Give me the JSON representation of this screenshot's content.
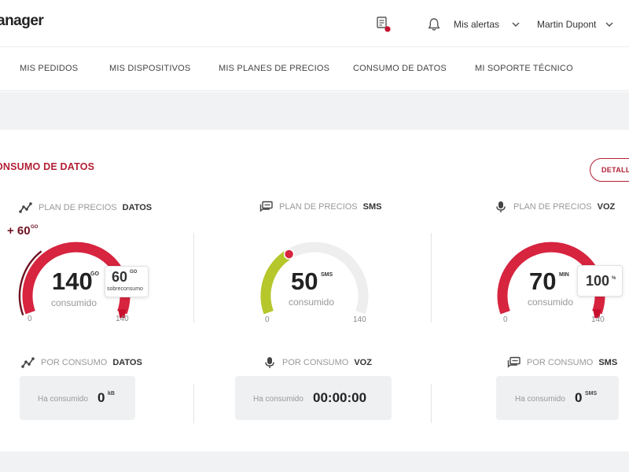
{
  "header": {
    "logo_text": "anager",
    "alerts_label": "Mis alertas",
    "user_name": "Martin Dupont"
  },
  "nav": {
    "items": [
      "MIS PEDIDOS",
      "MIS DISPOSITIVOS",
      "MIS PLANES DE PRECIOS",
      "CONSUMO DE DATOS",
      "MI SOPORTE TÉCNICO"
    ]
  },
  "section": {
    "title": "ONSUMO DE DATOS",
    "details_button": "DETALLE"
  },
  "plans": [
    {
      "prefix": "PLAN DE PRECIOS",
      "type": "DATOS",
      "icon": "data-trend-icon",
      "value": "140",
      "unit": "GO",
      "label": "consumido",
      "min": "0",
      "max": "140",
      "fraction": 1.0,
      "color": "#d7243f",
      "bubble_value": "60",
      "bubble_unit": "GO",
      "bubble_label": "sobreconsumo",
      "overage": "+ 60",
      "overage_unit": "GO"
    },
    {
      "prefix": "PLAN DE PRECIOS",
      "type": "SMS",
      "icon": "sms-icon",
      "value": "50",
      "unit": "SMS",
      "label": "consumido",
      "min": "0",
      "max": "140",
      "fraction": 0.357,
      "color": "#b5c72a"
    },
    {
      "prefix": "PLAN DE PRECIOS",
      "type": "VOZ",
      "icon": "microphone-icon",
      "value": "70",
      "unit": "MIN",
      "label": "consumido",
      "min": "0",
      "max": "140",
      "fraction": 1.0,
      "color": "#d7243f",
      "bubble_value": "100",
      "bubble_unit": "%"
    }
  ],
  "consumption": [
    {
      "prefix": "POR CONSUMO",
      "type": "DATOS",
      "icon": "data-trend-icon",
      "label": "Ha consumido",
      "value": "0",
      "unit": "kB"
    },
    {
      "prefix": "POR CONSUMO",
      "type": "VOZ",
      "icon": "microphone-icon",
      "label": "Ha consumido",
      "value": "00:00:00",
      "unit": ""
    },
    {
      "prefix": "POR CONSUMO",
      "type": "SMS",
      "icon": "sms-icon",
      "label": "Ha consumido",
      "value": "0",
      "unit": "SMS"
    }
  ],
  "colors": {
    "brand": "#b21f35",
    "gauge_track": "#eeeeee",
    "gauge_red": "#d7243f",
    "gauge_green": "#b5c72a",
    "overage": "#6e1221"
  }
}
